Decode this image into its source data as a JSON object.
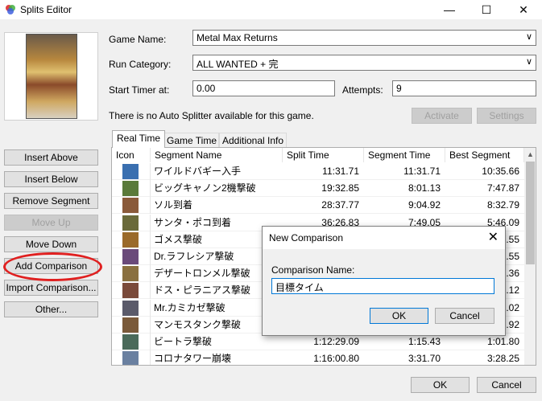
{
  "window": {
    "title": "Splits Editor",
    "minimize_glyph": "—",
    "maximize_glyph": "☐",
    "close_glyph": "✕"
  },
  "form": {
    "game_name_label": "Game Name:",
    "game_name_value": "Metal Max Returns",
    "run_category_label": "Run Category:",
    "run_category_value": "ALL WANTED + 完",
    "start_timer_label": "Start Timer at:",
    "start_timer_value": "0.00",
    "attempts_label": "Attempts:",
    "attempts_value": "9",
    "auto_splitter_text": "There is no Auto Splitter available for this game.",
    "activate_label": "Activate",
    "settings_label": "Settings"
  },
  "tabs": [
    "Real Time",
    "Game Time",
    "Additional Info"
  ],
  "side_buttons": {
    "insert_above": "Insert Above",
    "insert_below": "Insert Below",
    "remove_segment": "Remove Segment",
    "move_up": "Move Up",
    "move_down": "Move Down",
    "add_comparison": "Add Comparison",
    "import_comparison": "Import Comparison...",
    "other": "Other..."
  },
  "grid": {
    "headers": [
      "Icon",
      "Segment Name",
      "Split Time",
      "Segment Time",
      "Best Segment"
    ],
    "rows": [
      {
        "name": "ワイルドバギー入手",
        "split": "11:31.71",
        "segment": "11:31.71",
        "best": "10:35.66",
        "color": "#3a6fb0"
      },
      {
        "name": "ビッグキャノン2機撃破",
        "split": "19:32.85",
        "segment": "8:01.13",
        "best": "7:47.87",
        "color": "#5a7a3a"
      },
      {
        "name": "ソル到着",
        "split": "28:37.77",
        "segment": "9:04.92",
        "best": "8:32.79",
        "color": "#8a5a3a"
      },
      {
        "name": "サンタ・ポコ到着",
        "split": "36:26.83",
        "segment": "7:49.05",
        "best": "5:46.09",
        "color": "#6a6a3a"
      },
      {
        "name": "ゴメス撃破",
        "split": "",
        "segment": "",
        "best": "9.55",
        "color": "#9a6a2a"
      },
      {
        "name": "Dr.ラフレシア撃破",
        "split": "",
        "segment": "",
        "best": "6.55",
        "color": "#6a4a7a"
      },
      {
        "name": "デザートロンメル撃破",
        "split": "",
        "segment": "",
        "best": "5.36",
        "color": "#8a7040"
      },
      {
        "name": "ドス・ピラニアス撃破",
        "split": "",
        "segment": "",
        "best": "6.12",
        "color": "#7a4a3a"
      },
      {
        "name": "Mr.カミカゼ撃破",
        "split": "",
        "segment": "",
        "best": "2.02",
        "color": "#5a5a6a"
      },
      {
        "name": "マンモスタンク撃破",
        "split": "",
        "segment": "",
        "best": "5.92",
        "color": "#7a5a3a"
      },
      {
        "name": "ビートラ撃破",
        "split": "1:12:29.09",
        "segment": "1:15.43",
        "best": "1:01.80",
        "color": "#4a6a5a"
      },
      {
        "name": "コロナタワー崩壊",
        "split": "1:16:00.80",
        "segment": "3:31.70",
        "best": "3:28.25",
        "color": "#6a80a0"
      }
    ]
  },
  "footer": {
    "ok_label": "OK",
    "cancel_label": "Cancel"
  },
  "dialog": {
    "title": "New Comparison",
    "close_glyph": "✕",
    "field_label": "Comparison Name:",
    "field_value": "目標タイム",
    "ok_label": "OK",
    "cancel_label": "Cancel"
  },
  "colors": {
    "focus_blue": "#0078d7",
    "highlight_red": "#e02020"
  }
}
